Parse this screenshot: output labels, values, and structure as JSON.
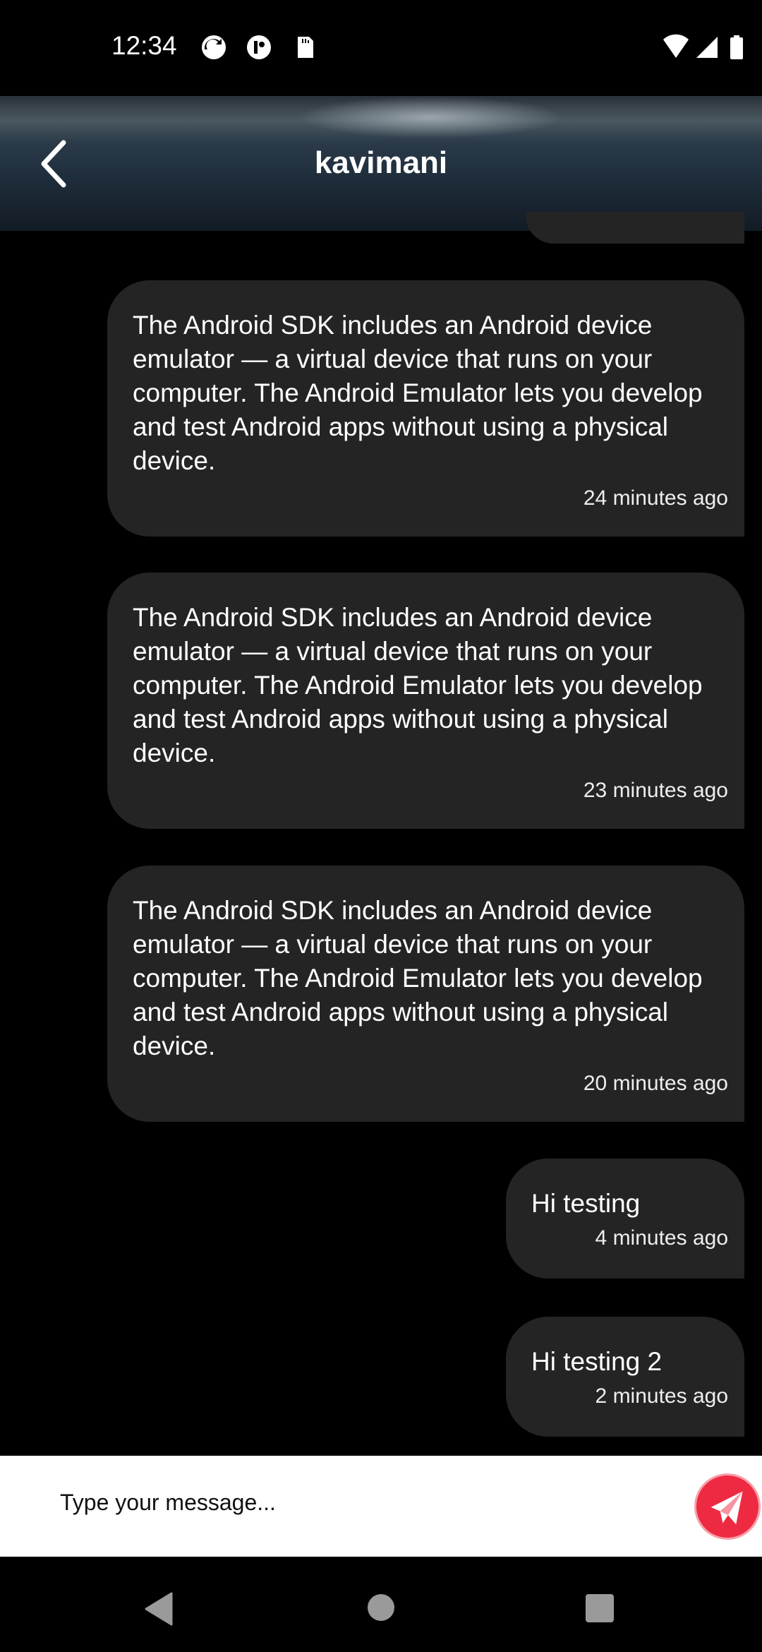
{
  "status_bar": {
    "time": "12:34"
  },
  "header": {
    "title": "kavimani"
  },
  "messages": [
    {
      "text": "The Android SDK includes an Android device emulator — a virtual device that runs on your computer. The Android Emulator lets you develop and test Android apps without using a physical device.",
      "time": "24 minutes ago"
    },
    {
      "text": "The Android SDK includes an Android device emulator — a virtual device that runs on your computer. The Android Emulator lets you develop and test Android apps without using a physical device.",
      "time": "23 minutes ago"
    },
    {
      "text": "The Android SDK includes an Android device emulator — a virtual device that runs on your computer. The Android Emulator lets you develop and test Android apps without using a physical device.",
      "time": "20 minutes ago"
    },
    {
      "text": "Hi testing",
      "time": "4 minutes ago"
    },
    {
      "text": "Hi testing 2",
      "time": "2 minutes ago"
    }
  ],
  "composer": {
    "placeholder": "Type your message...",
    "value": ""
  },
  "colors": {
    "bubble": "#242424",
    "send_button": "#ee2a42"
  }
}
